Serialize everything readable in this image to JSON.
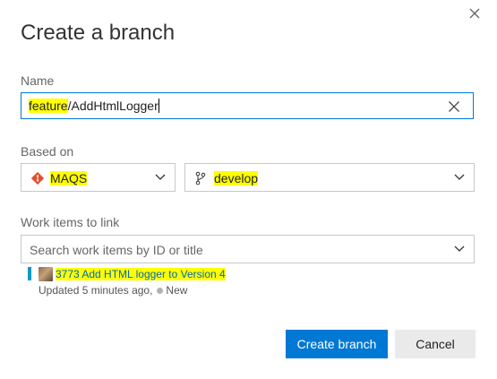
{
  "dialog": {
    "title": "Create a branch",
    "close_icon": "close-icon"
  },
  "name": {
    "label": "Name",
    "value_prefix": "feature",
    "value_suffix": "/AddHtmlLogger",
    "highlight_color": "#ffff00"
  },
  "based_on": {
    "label": "Based on",
    "repo": {
      "value": "MAQS",
      "icon": "git-icon"
    },
    "branch": {
      "value": "develop",
      "icon": "branch-icon"
    }
  },
  "work_items": {
    "label": "Work items to link",
    "placeholder": "Search work items by ID or title",
    "items": [
      {
        "id": "3773",
        "title": "Add HTML logger to Version 4",
        "updated": "Updated 5 minutes ago,",
        "state": "New"
      }
    ]
  },
  "actions": {
    "primary_label": "Create branch",
    "secondary_label": "Cancel",
    "primary_color": "#0078d4"
  }
}
